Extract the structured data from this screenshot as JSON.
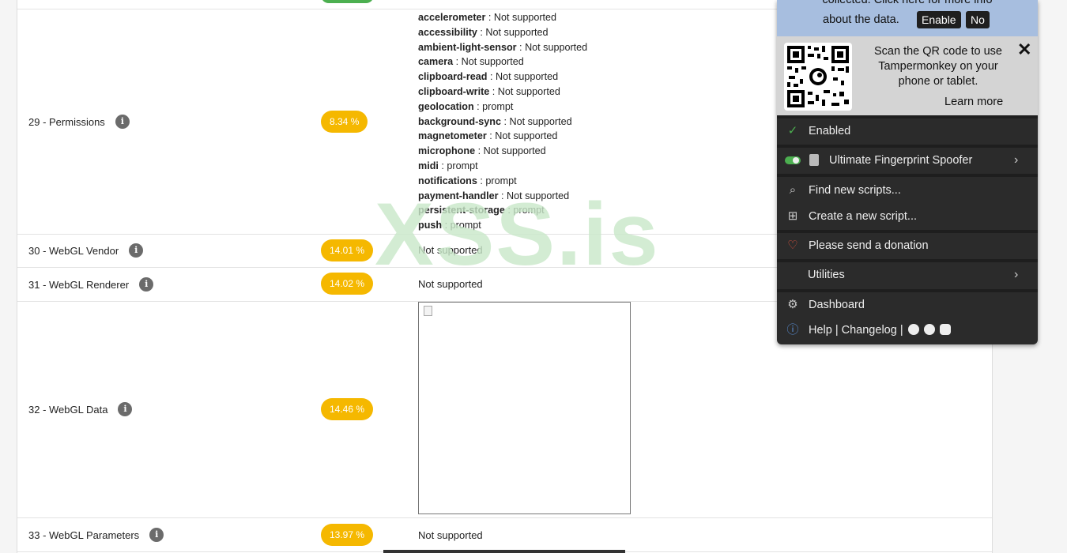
{
  "rows": [
    {
      "label": "29 - Permissions",
      "badge": "8.34 %"
    },
    {
      "label": "30 - WebGL Vendor",
      "badge": "14.01 %",
      "value": "Not supported"
    },
    {
      "label": "31 - WebGL Renderer",
      "badge": "14.02 %",
      "value": "Not supported"
    },
    {
      "label": "32 - WebGL Data",
      "badge": "14.46 %"
    },
    {
      "label": "33 - WebGL Parameters",
      "badge": "13.97 %",
      "value": "Not supported"
    }
  ],
  "permissions": [
    {
      "name": "accelerometer",
      "value": "Not supported"
    },
    {
      "name": "accessibility",
      "value": "Not supported"
    },
    {
      "name": "ambient-light-sensor",
      "value": "Not supported"
    },
    {
      "name": "camera",
      "value": "Not supported"
    },
    {
      "name": "clipboard-read",
      "value": "Not supported"
    },
    {
      "name": "clipboard-write",
      "value": "Not supported"
    },
    {
      "name": "geolocation",
      "value": "prompt"
    },
    {
      "name": "background-sync",
      "value": "Not supported"
    },
    {
      "name": "magnetometer",
      "value": "Not supported"
    },
    {
      "name": "microphone",
      "value": "Not supported"
    },
    {
      "name": "midi",
      "value": "prompt"
    },
    {
      "name": "notifications",
      "value": "prompt"
    },
    {
      "name": "payment-handler",
      "value": "Not supported"
    },
    {
      "name": "persistent-storage",
      "value": "prompt"
    },
    {
      "name": "push",
      "value": "prompt"
    }
  ],
  "separator": " : ",
  "info_glyph": "i",
  "watermark": "XSS.is",
  "tampermonkey": {
    "notice_line1": "collected. Click here for more info",
    "notice_line2": "about the data.",
    "enable_btn": "Enable",
    "no_btn": "No",
    "qr_text": "Scan the QR code to use Tampermonkey on your phone or tablet.",
    "learn_more": "Learn more",
    "close": "✕",
    "enabled": "Enabled",
    "script_name": "Ultimate Fingerprint Spoofer",
    "find_scripts": "Find new scripts...",
    "create_script": "Create a new script...",
    "donation": "Please send a donation",
    "utilities": "Utilities",
    "dashboard": "Dashboard",
    "help": "Help | Changelog |",
    "icons": {
      "check": "✓",
      "search": "⌕",
      "plus": "⊞",
      "heart": "♡",
      "gear": "⚙",
      "info": "ⓘ",
      "chevron": "›"
    },
    "colors": {
      "notice_bg": "#a7bedf",
      "qr_bg": "#d4d4d4",
      "menu_bg": "#2b2b2b",
      "toggle_on": "#4caf50",
      "heart": "#e0533f",
      "info": "#5a8fd6"
    }
  },
  "colors": {
    "badge": "#f5b800",
    "badge_top": "#4caf50",
    "watermark": "#c9e8c9"
  }
}
